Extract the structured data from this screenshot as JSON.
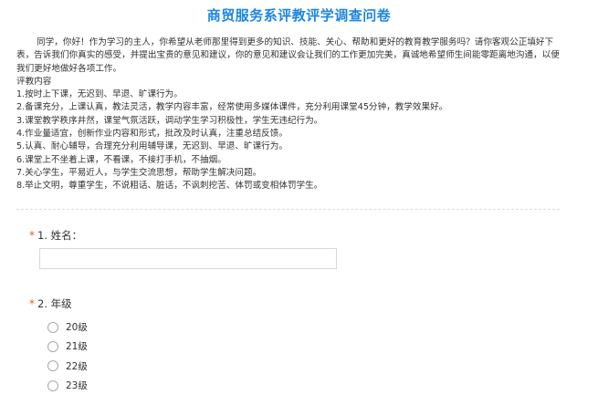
{
  "title": "商贸服务系评教评学调查问卷",
  "intro": {
    "lead": "同学，你好！作为学习的主人，你希望从老师那里得到更多的知识、技能、关心、帮助和更好的教育教学服务吗？请你客观公正填好下表，告诉我们你真实的感受，并提出宝贵的意见和建议，你的意见和建议会让我们的工作更加完美，真诚地希望师生间能零距离地沟通，以便我们更好地做好各项工作。",
    "heading": "评教内容",
    "items": [
      "1.按时上下课，无迟到、早退、旷课行为。",
      "2.备课充分，上课认真，教法灵活，教学内容丰富，经常使用多媒体课件，充分利用课堂45分钟，教学效果好。",
      "3.课堂教学秩序井然，课堂气氛活跃，调动学生学习积极性，学生无违纪行为。",
      "4.作业量适宜，创新作业内容和形式，批改及时认真，注重总结反馈。",
      "5.认真、耐心辅导，合理充分利用辅导课，无迟到、早退、旷课行为。",
      "6.课堂上不坐着上课，不看课，不接打手机，不抽烟。",
      "7.关心学生，平易近人，与学生交流思想，帮助学生解决问题。",
      "8.举止文明，尊重学生，不说粗话、脏话，不讽刺挖苦、体罚或变相体罚学生。"
    ]
  },
  "questions": {
    "q1": {
      "required_mark": "*",
      "label": "1. 姓名：",
      "value": ""
    },
    "q2": {
      "required_mark": "*",
      "label": "2. 年级",
      "options": [
        "20级",
        "21级",
        "22级",
        "23级"
      ]
    }
  }
}
